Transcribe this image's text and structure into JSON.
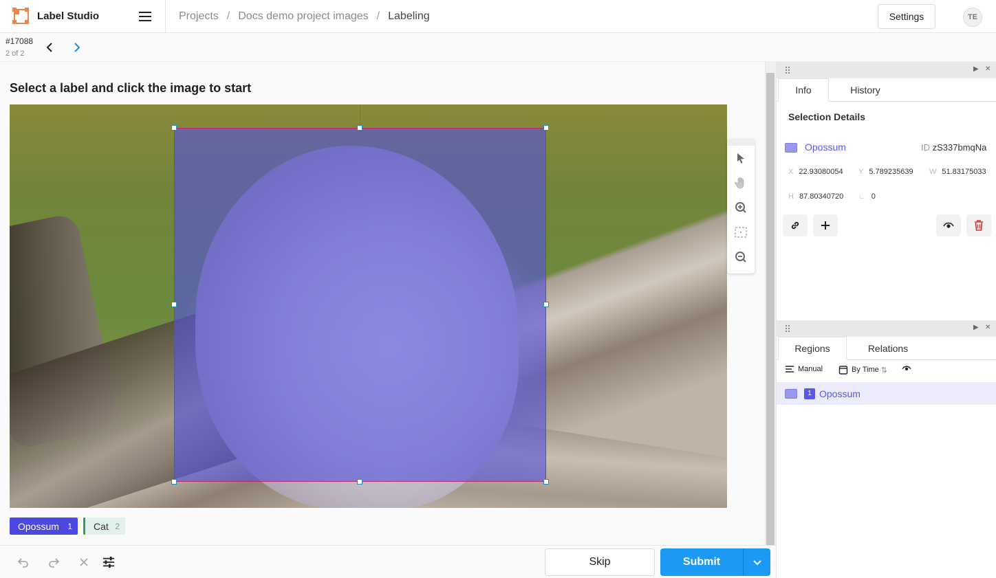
{
  "app": {
    "name": "Label Studio"
  },
  "breadcrumb": [
    "Projects",
    "Docs demo project images",
    "Labeling"
  ],
  "breadcrumb_sep": "/",
  "header": {
    "settings_label": "Settings",
    "avatar_initials": "TE"
  },
  "task": {
    "id": "#17088",
    "position": "2 of 2"
  },
  "canvas": {
    "instruction": "Select a label and click the image to start"
  },
  "labels": [
    {
      "name": "Opossum",
      "hotkey": "1",
      "color": "#4b49e0"
    },
    {
      "name": "Cat",
      "hotkey": "2",
      "color": "#2f9a6a"
    }
  ],
  "actions": {
    "skip_label": "Skip",
    "submit_label": "Submit"
  },
  "info_panel": {
    "tabs": [
      "Info",
      "History"
    ],
    "active_tab": "Info",
    "title": "Selection Details",
    "region_label": "Opossum",
    "id_key": "ID",
    "id_value": "zS337bmqNa",
    "x_key": "X",
    "x_value": "22.93080054",
    "y_key": "Y",
    "y_value": "5.789235639",
    "w_key": "W",
    "w_value": "51.83175033",
    "h_key": "H",
    "h_value": "87.80340720",
    "rotation_value": "0"
  },
  "regions_panel": {
    "tabs": [
      "Regions",
      "Relations"
    ],
    "active_tab": "Regions",
    "order_label": "Manual",
    "sort_label": "By Time",
    "items": [
      {
        "index": "1",
        "label": "Opossum"
      }
    ]
  },
  "colors": {
    "accent": "#1a9af2",
    "region_fill": "#5452dc",
    "label_purple": "#5b58e6"
  }
}
